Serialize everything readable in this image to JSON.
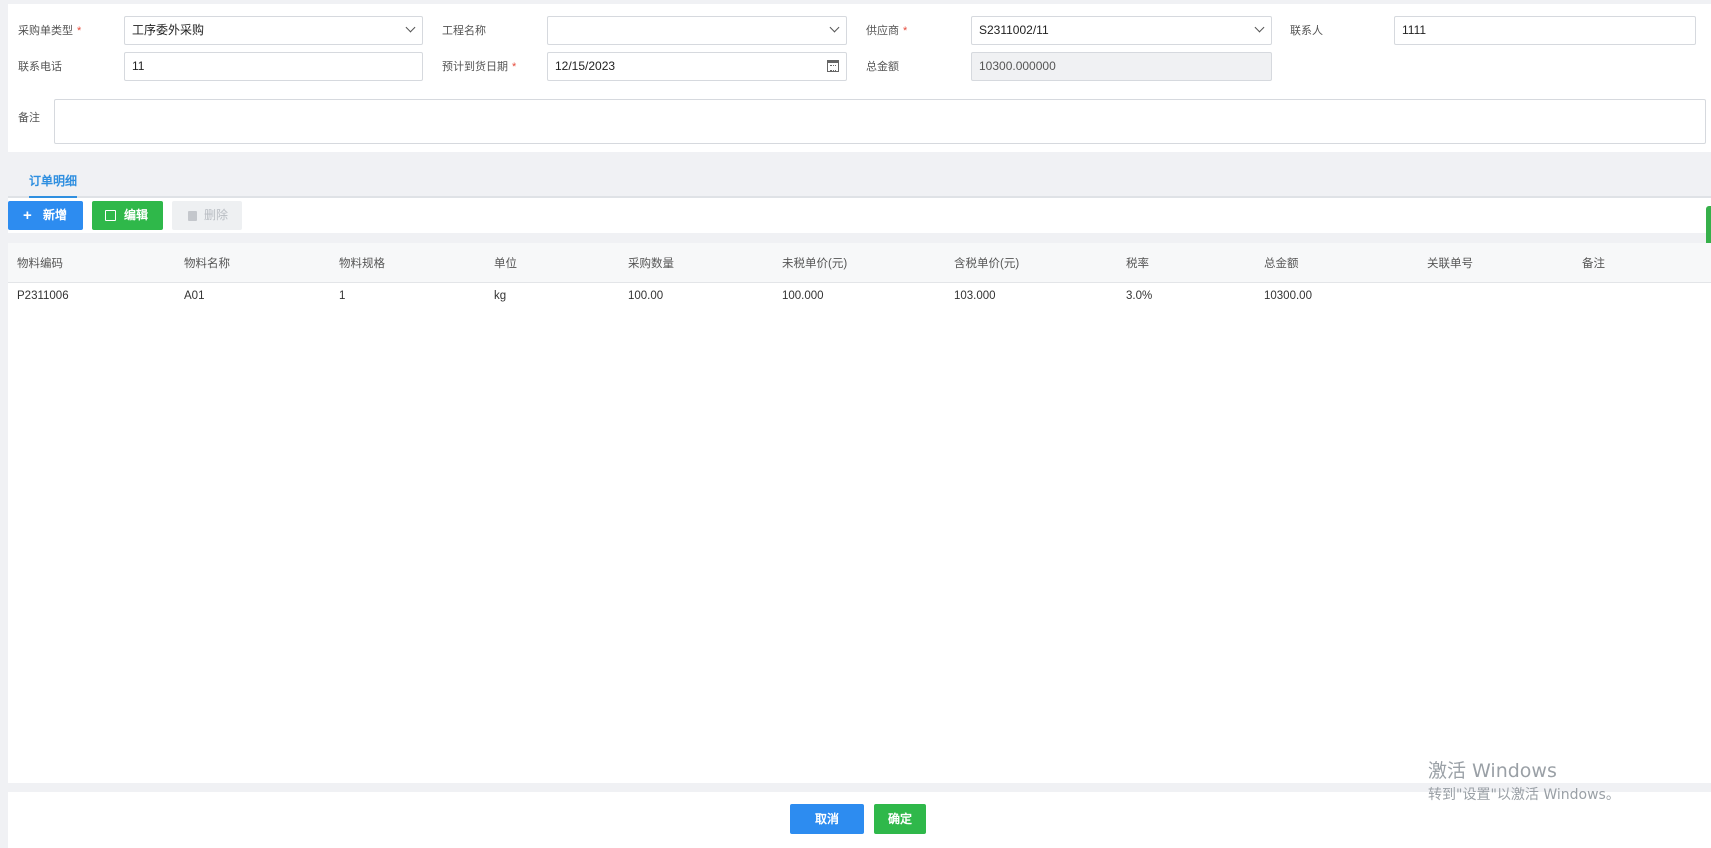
{
  "form": {
    "order_type": {
      "label": "采购单类型",
      "value": "工序委外采购",
      "required_mark": "*"
    },
    "project_name": {
      "label": "工程名称",
      "value": ""
    },
    "supplier": {
      "label": "供应商",
      "value": "S2311002/11",
      "required_mark": "*"
    },
    "contact": {
      "label": "联系人",
      "value": "1111"
    },
    "phone": {
      "label": "联系电话",
      "value": "11"
    },
    "arrival_date": {
      "label": "预计到货日期",
      "value": "12/15/2023",
      "required_mark": "*"
    },
    "total_amount": {
      "label": "总金额",
      "value": "10300.000000"
    },
    "remark": {
      "label": "备注",
      "value": ""
    }
  },
  "tabs": [
    {
      "label": "订单明细",
      "active": true
    }
  ],
  "toolbar": {
    "add_label": "新增",
    "edit_label": "编辑",
    "delete_label": "删除"
  },
  "table": {
    "columns": [
      "物料编码",
      "物料名称",
      "物料规格",
      "单位",
      "采购数量",
      "未税单价(元)",
      "含税单价(元)",
      "税率",
      "总金额",
      "关联单号",
      "备注"
    ],
    "rows": [
      [
        "P2311006",
        "A01",
        "1",
        "kg",
        "100.00",
        "100.000",
        "103.000",
        "3.0%",
        "10300.00",
        "",
        ""
      ]
    ]
  },
  "footer": {
    "cancel_label": "取消",
    "confirm_label": "确定"
  },
  "watermark": {
    "line1": "激活 Windows",
    "line2": "转到\"设置\"以激活 Windows。"
  },
  "colors": {
    "primary": "#2d8cf0",
    "success": "#2fb84a",
    "required": "#e64a3b",
    "tab_active": "#2f8fe0"
  },
  "icons": {
    "dropdown": "chevron-down-icon",
    "date": "calendar-icon",
    "add": "plus-icon",
    "edit": "edit-icon",
    "delete": "trash-icon"
  }
}
